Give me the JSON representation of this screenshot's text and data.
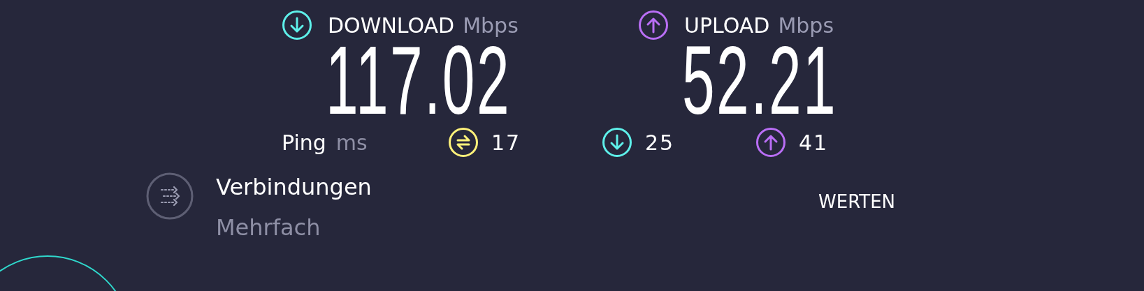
{
  "results": [
    {
      "kind": "download",
      "label": "DOWNLOAD",
      "unit": "Mbps",
      "value": "117.02",
      "color": "#5ef0ea"
    },
    {
      "kind": "upload",
      "label": "UPLOAD",
      "unit": "Mbps",
      "value": "52.21",
      "color": "#b96ef5"
    }
  ],
  "ping": {
    "label": "Ping",
    "unit": "ms",
    "items": [
      {
        "kind": "idle",
        "value": "17",
        "color": "#fff27a"
      },
      {
        "kind": "download",
        "value": "25",
        "color": "#5ef0ea"
      },
      {
        "kind": "upload",
        "value": "41",
        "color": "#b96ef5"
      }
    ]
  },
  "connections": {
    "title": "Verbindungen",
    "value": "Mehrfach"
  },
  "rate_button": "WERTEN"
}
